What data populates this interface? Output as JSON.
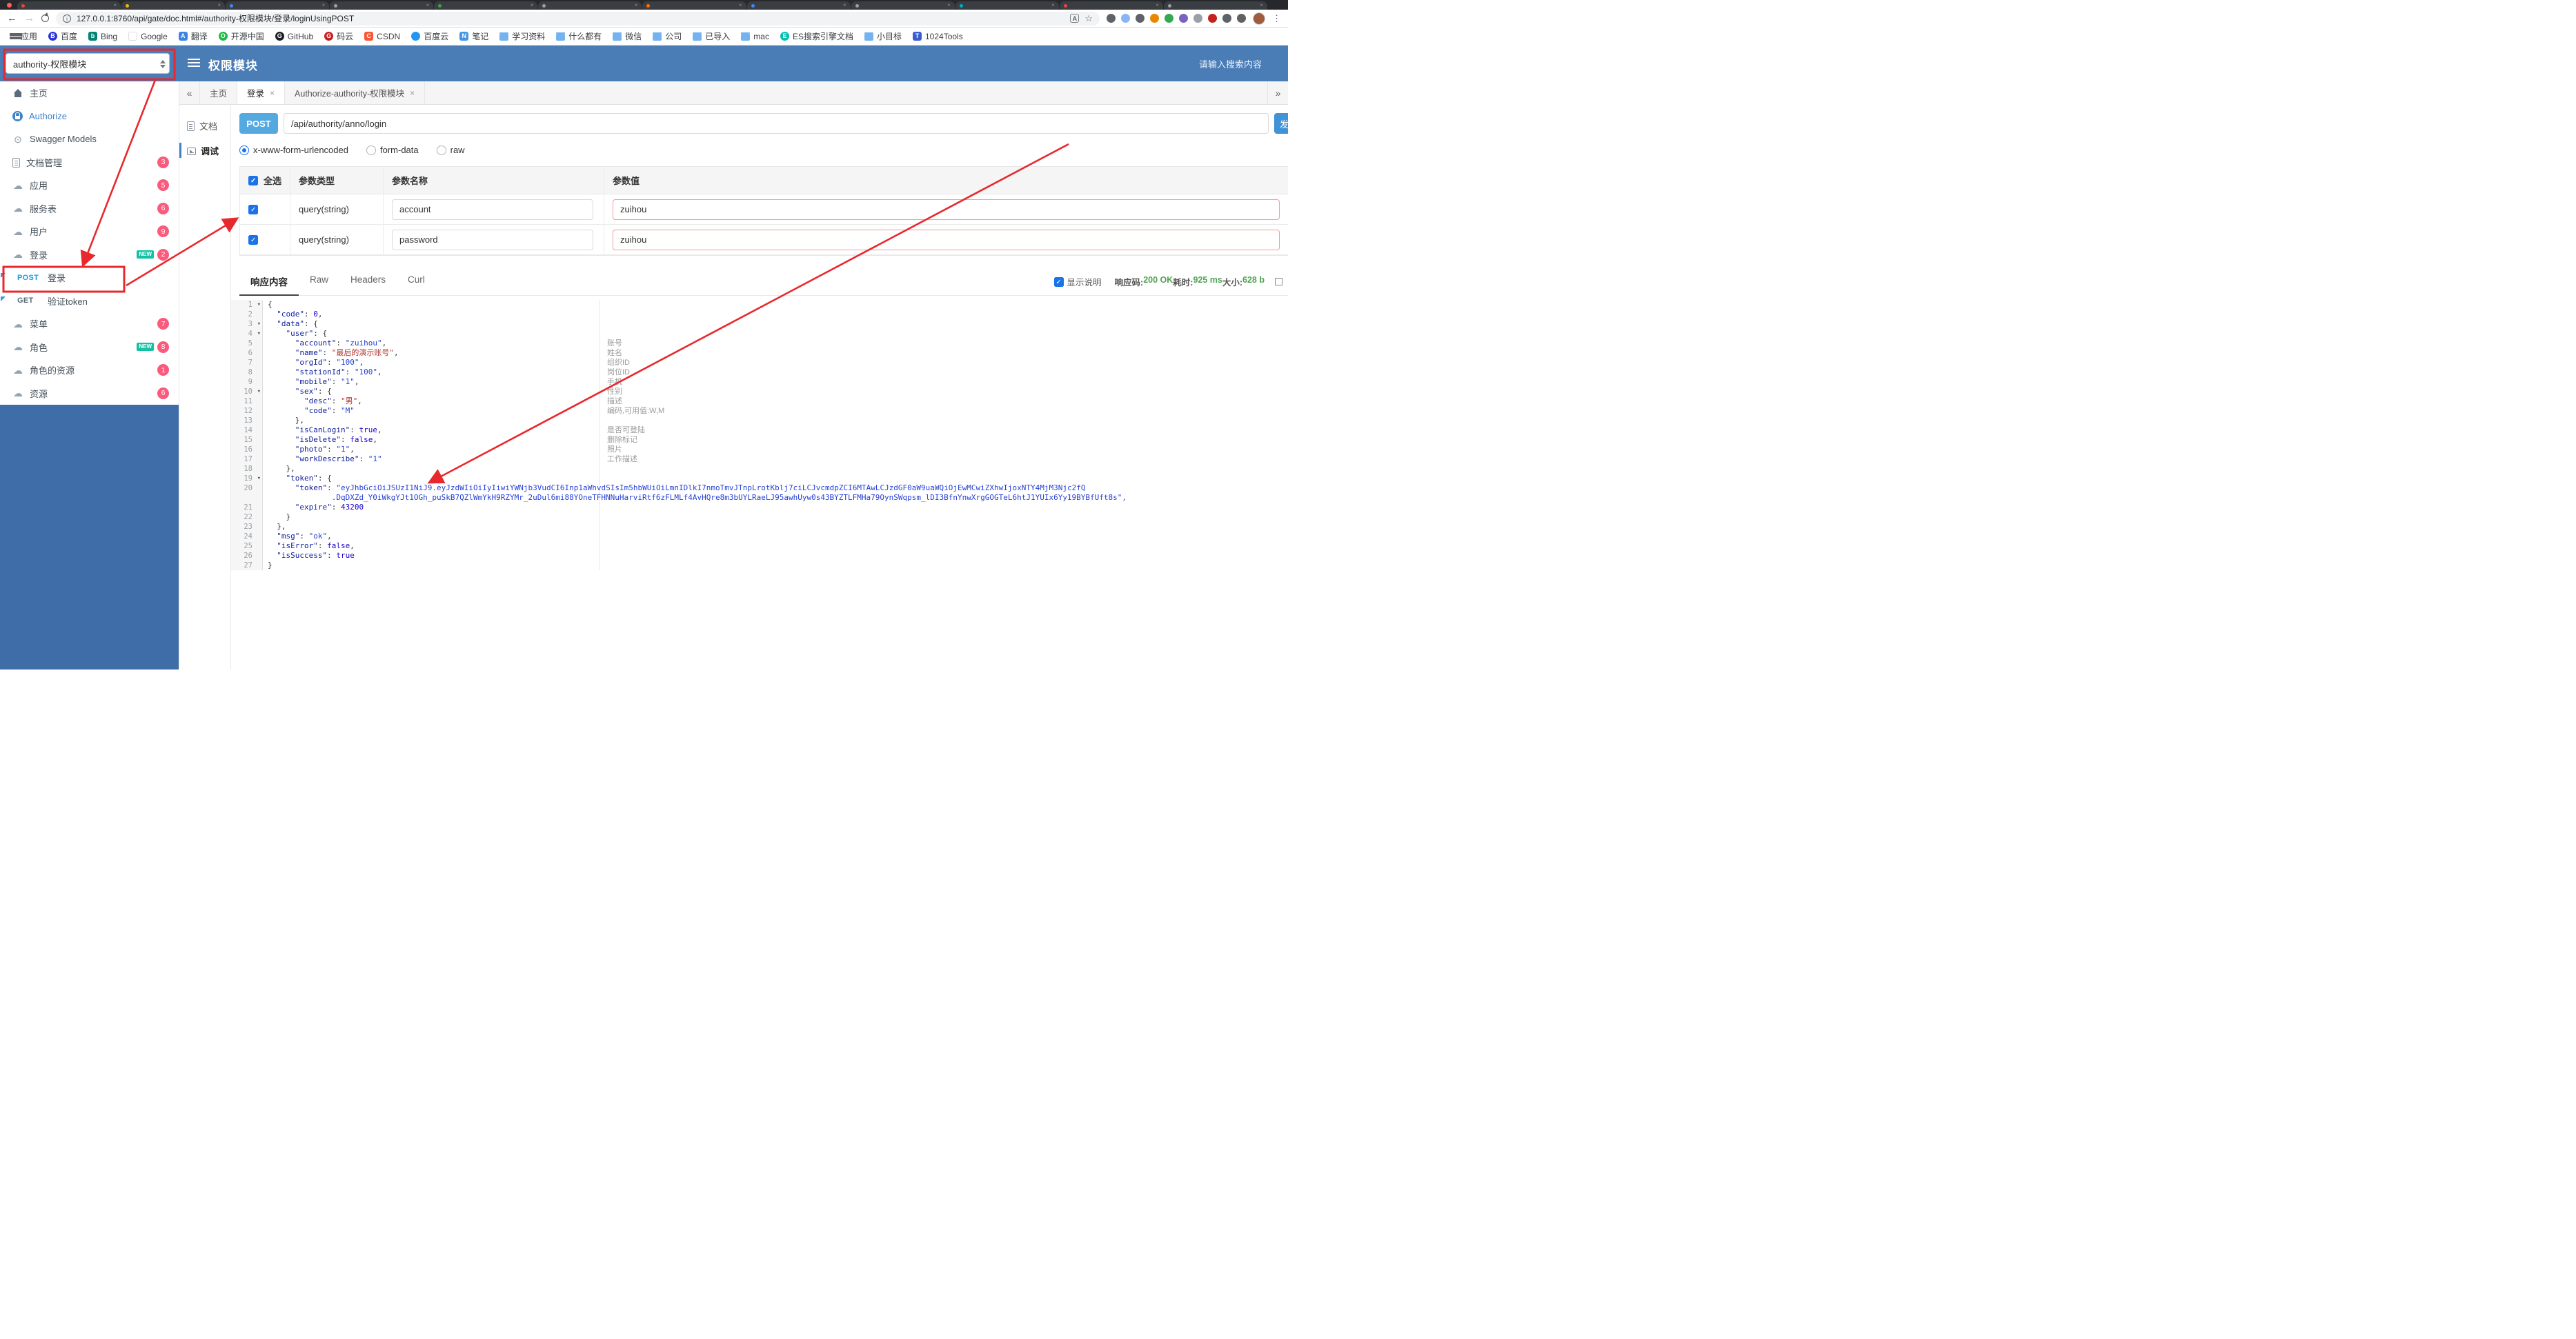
{
  "colors": {
    "header_blue": "#4a7cb5",
    "sidebar_footer_blue": "#3e6da7",
    "count_badge_pink": "#fa5a7c",
    "new_badge_teal": "#13c2a3",
    "post_badge_blue": "#54a9e0",
    "send_button_blue": "#4193d5",
    "method_post_text": "#12a3e3",
    "success_green": "#52a352",
    "annotation_red": "#e8282d",
    "checkbox_blue": "#1a73e8"
  },
  "browser": {
    "url": "127.0.0.1:8760/api/gate/doc.html#/authority-权限模块/登录/loginUsingPOST",
    "tabs": [
      {
        "favicon": "#e8453c"
      },
      {
        "favicon": "#f4b400"
      },
      {
        "favicon": "#4285f4"
      },
      {
        "favicon": "#9aa0a6"
      },
      {
        "favicon": "#43a047"
      },
      {
        "favicon": "#9aa0a6"
      },
      {
        "favicon": "#ff6d00"
      },
      {
        "favicon": "#4285f4"
      },
      {
        "favicon": "#9aa0a6"
      },
      {
        "favicon": "#00acc1"
      },
      {
        "favicon": "#e8453c"
      },
      {
        "favicon": "#9aa0a6"
      }
    ],
    "extensions": [
      {
        "color": "#5f6368"
      },
      {
        "color": "#8ab4f8"
      },
      {
        "color": "#5f6368"
      },
      {
        "color": "#ea8600"
      },
      {
        "color": "#34a853"
      },
      {
        "color": "#7b61c4"
      },
      {
        "color": "#9aa0a6"
      },
      {
        "color": "#c5221f"
      },
      {
        "color": "#5f6368"
      },
      {
        "color": "#616161"
      }
    ],
    "bookmarks": [
      {
        "icon": "apps-grid-icon",
        "label": "应用"
      },
      {
        "icon": "baidu-icon",
        "label": "百度"
      },
      {
        "icon": "bing-icon",
        "label": "Bing"
      },
      {
        "icon": "google-icon",
        "label": "Google"
      },
      {
        "icon": "translate-bm-icon",
        "label": "翻译"
      },
      {
        "icon": "oschina-icon",
        "label": "开源中国"
      },
      {
        "icon": "github-icon",
        "label": "GitHub"
      },
      {
        "icon": "gitee-icon",
        "label": "码云"
      },
      {
        "icon": "csdn-icon",
        "label": "CSDN"
      },
      {
        "icon": "baidu-cloud-icon",
        "label": "百度云"
      },
      {
        "icon": "note-icon",
        "label": "笔记"
      },
      {
        "icon": "folder-icon",
        "label": "学习资料"
      },
      {
        "icon": "folder-icon",
        "label": "什么都有"
      },
      {
        "icon": "folder-icon",
        "label": "微信"
      },
      {
        "icon": "folder-icon",
        "label": "公司"
      },
      {
        "icon": "folder-icon",
        "label": "已导入"
      },
      {
        "icon": "folder-icon",
        "label": "mac"
      },
      {
        "icon": "elastic-icon",
        "label": "ES搜索引擎文档"
      },
      {
        "icon": "folder-icon",
        "label": "小目标"
      },
      {
        "icon": "tools-icon",
        "label": "1024Tools"
      }
    ]
  },
  "header": {
    "group_select_value": "authority-权限模块",
    "title": "权限模块",
    "search_placeholder": "请输入搜索内容"
  },
  "sidebar": {
    "items": [
      {
        "icon": "home-icon",
        "label": "主页"
      },
      {
        "icon": "lock-icon",
        "label": "Authorize",
        "is_link": true
      },
      {
        "icon": "models-icon",
        "label": "Swagger Models"
      },
      {
        "icon": "doc-manage-icon",
        "label": "文档管理",
        "badge": "3"
      },
      {
        "icon": "cloud-icon",
        "label": "应用",
        "badge": "5"
      },
      {
        "icon": "cloud-icon",
        "label": "服务表",
        "badge": "6"
      },
      {
        "icon": "cloud-icon",
        "label": "用户",
        "badge": "9"
      },
      {
        "icon": "cloud-icon",
        "label": "登录",
        "badge": "2",
        "new_tag": "NEW"
      },
      {
        "method": "POST",
        "label": "登录",
        "is_api": true,
        "flagged": true
      },
      {
        "method": "GET",
        "label": "验证token",
        "is_api": true,
        "flagged": true
      },
      {
        "icon": "cloud-icon",
        "label": "菜单",
        "badge": "7"
      },
      {
        "icon": "cloud-icon",
        "label": "角色",
        "badge": "8",
        "new_tag": "NEW"
      },
      {
        "icon": "cloud-icon",
        "label": "角色的资源",
        "badge": "1"
      },
      {
        "icon": "cloud-icon",
        "label": "资源",
        "badge": "6"
      }
    ]
  },
  "doc_tabs": [
    {
      "label": "主页"
    },
    {
      "label": "登录",
      "closable": true,
      "active": true
    },
    {
      "label": "Authorize-authority-权限模块",
      "closable": true
    }
  ],
  "subnav": [
    {
      "icon": "doc-icon",
      "label": "文档"
    },
    {
      "icon": "debug-icon",
      "label": "调试",
      "active": true
    }
  ],
  "request": {
    "method": "POST",
    "path": "/api/authority/anno/login",
    "send_label": "发送",
    "content_types": [
      {
        "label": "x-www-form-urlencoded",
        "selected": true
      },
      {
        "label": "form-data"
      },
      {
        "label": "raw"
      }
    ],
    "params_table": {
      "select_all_label": "全选",
      "headers": [
        "参数类型",
        "参数名称",
        "参数值"
      ],
      "rows": [
        {
          "checked": true,
          "type": "query(string)",
          "name": "account",
          "value": "zuihou"
        },
        {
          "checked": true,
          "type": "query(string)",
          "name": "password",
          "value": "zuihou"
        }
      ]
    }
  },
  "response": {
    "tabs": [
      {
        "label": "响应内容",
        "active": true
      },
      {
        "label": "Raw"
      },
      {
        "label": "Headers"
      },
      {
        "label": "Curl"
      }
    ],
    "show_desc_label": "显示说明",
    "meta": [
      {
        "label": "响应码:",
        "value": "200 OK"
      },
      {
        "label": "耗时:",
        "value": "925 ms"
      },
      {
        "label": "大小:",
        "value": "628 b"
      }
    ],
    "lines": [
      {
        "no": 1,
        "fold": true,
        "text": "{"
      },
      {
        "no": 2,
        "text": "  \"code\": 0,"
      },
      {
        "no": 3,
        "fold": true,
        "text": "  \"data\": {"
      },
      {
        "no": 4,
        "fold": true,
        "text": "    \"user\": {"
      },
      {
        "no": 5,
        "text": "      \"account\": \"zuihou\",",
        "ann": "账号"
      },
      {
        "no": 6,
        "text": "      \"name\": \"最后的演示账号\",",
        "ann": "姓名"
      },
      {
        "no": 7,
        "text": "      \"orgId\": \"100\",",
        "ann": "组织ID"
      },
      {
        "no": 8,
        "text": "      \"stationId\": \"100\",",
        "ann": "岗位ID"
      },
      {
        "no": 9,
        "text": "      \"mobile\": \"1\",",
        "ann": "手机"
      },
      {
        "no": 10,
        "fold": true,
        "text": "      \"sex\": {",
        "ann": "性别"
      },
      {
        "no": 11,
        "text": "        \"desc\": \"男\",",
        "ann": "描述"
      },
      {
        "no": 12,
        "text": "        \"code\": \"M\"",
        "ann": "编码,可用值:W,M"
      },
      {
        "no": 13,
        "text": "      },"
      },
      {
        "no": 14,
        "text": "      \"isCanLogin\": true,",
        "ann": "是否可登陆"
      },
      {
        "no": 15,
        "text": "      \"isDelete\": false,",
        "ann": "删除标记"
      },
      {
        "no": 16,
        "text": "      \"photo\": \"1\",",
        "ann": "照片"
      },
      {
        "no": 17,
        "text": "      \"workDescribe\": \"1\"",
        "ann": "工作描述"
      },
      {
        "no": 18,
        "text": "    },"
      },
      {
        "no": 19,
        "fold": true,
        "text": "    \"token\": {"
      },
      {
        "no": 20,
        "text": "      \"token\": \"eyJhbGciOiJSUzI1NiJ9.eyJzdWIiOiIyIiwiYWNjb3VudCI6Inp1aWhvdSIsIm5hbWUiOiLmnIDlkI7nmoTmvJTnpLrotKblj7ciLCJvcmdpZCI6MTAwLCJzdGF0aW9uaWQiOjEwMCwiZXhwIjoxNTY4MjM3Njc2fQ",
        "cont": ".DqDXZd_Y0iWkgYJt1OGh_puSkB7QZlWmYkH9RZYMr_2uDul6mi88YOneTFHNNuHarviRtf6zFLMLf4AvHQre8m3bUYLRaeLJ95awhUyw0s43BYZTLFMHa79OynSWqpsm_lDI3BfnYnwXrgGOGTeL6htJ1YUIx6Yy19BYBfUft8s\","
      },
      {
        "no": 21,
        "text": "      \"expire\": 43200"
      },
      {
        "no": 22,
        "text": "    }"
      },
      {
        "no": 23,
        "text": "  },"
      },
      {
        "no": 24,
        "text": "  \"msg\": \"ok\","
      },
      {
        "no": 25,
        "text": "  \"isError\": false,"
      },
      {
        "no": 26,
        "text": "  \"isSuccess\": true"
      },
      {
        "no": 27,
        "text": "}"
      }
    ]
  }
}
